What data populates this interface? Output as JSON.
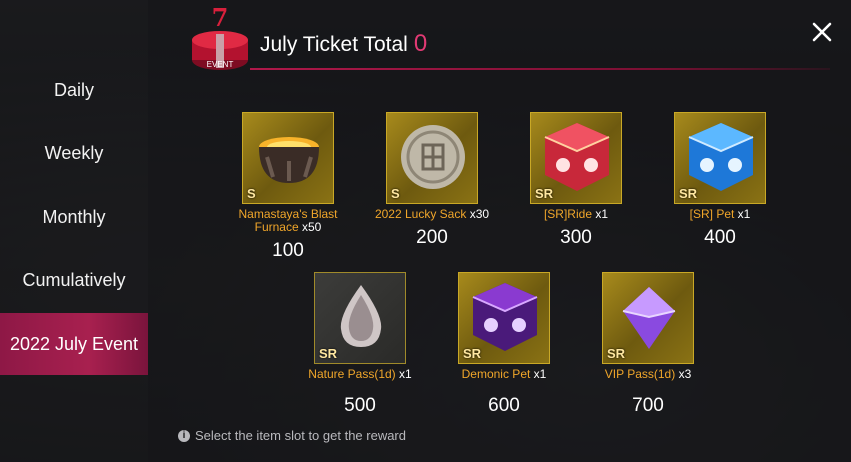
{
  "header": {
    "title": "July Ticket Total",
    "ticket_count": "0",
    "badge_number": "7",
    "badge_label": "EVENT"
  },
  "sidebar": {
    "items": [
      {
        "label": "Daily"
      },
      {
        "label": "Weekly"
      },
      {
        "label": "Monthly"
      },
      {
        "label": "Cumulatively"
      },
      {
        "label": "2022 July Event"
      }
    ],
    "active_index": 4
  },
  "rewards": [
    {
      "rank": "S",
      "name": "Namastaya's Blast Furnace",
      "qty": "x50",
      "cost": "100",
      "icon": "furnace-icon"
    },
    {
      "rank": "S",
      "name": "2022 Lucky Sack",
      "qty": "x30",
      "cost": "200",
      "icon": "lucky-coin-icon"
    },
    {
      "rank": "SR",
      "name": "[SR]Ride",
      "qty": "x1",
      "cost": "300",
      "icon": "ride-box-icon"
    },
    {
      "rank": "SR",
      "name": "[SR] Pet",
      "qty": "x1",
      "cost": "400",
      "icon": "pet-box-icon"
    },
    {
      "rank": "SR",
      "name": "Nature Pass(1d)",
      "qty": "x1",
      "cost": "500",
      "icon": "nature-crystal-icon"
    },
    {
      "rank": "SR",
      "name": "Demonic Pet",
      "qty": "x1",
      "cost": "600",
      "icon": "demonic-box-icon"
    },
    {
      "rank": "SR",
      "name": "VIP Pass(1d)",
      "qty": "x3",
      "cost": "700",
      "icon": "vip-gem-icon"
    }
  ],
  "hint": "Select the item slot to get the reward",
  "colors": {
    "accent": "#e23a74",
    "active_tab": "#a8204f",
    "item_name": "#f0a62a",
    "slot_gold": "#a78a1c"
  }
}
